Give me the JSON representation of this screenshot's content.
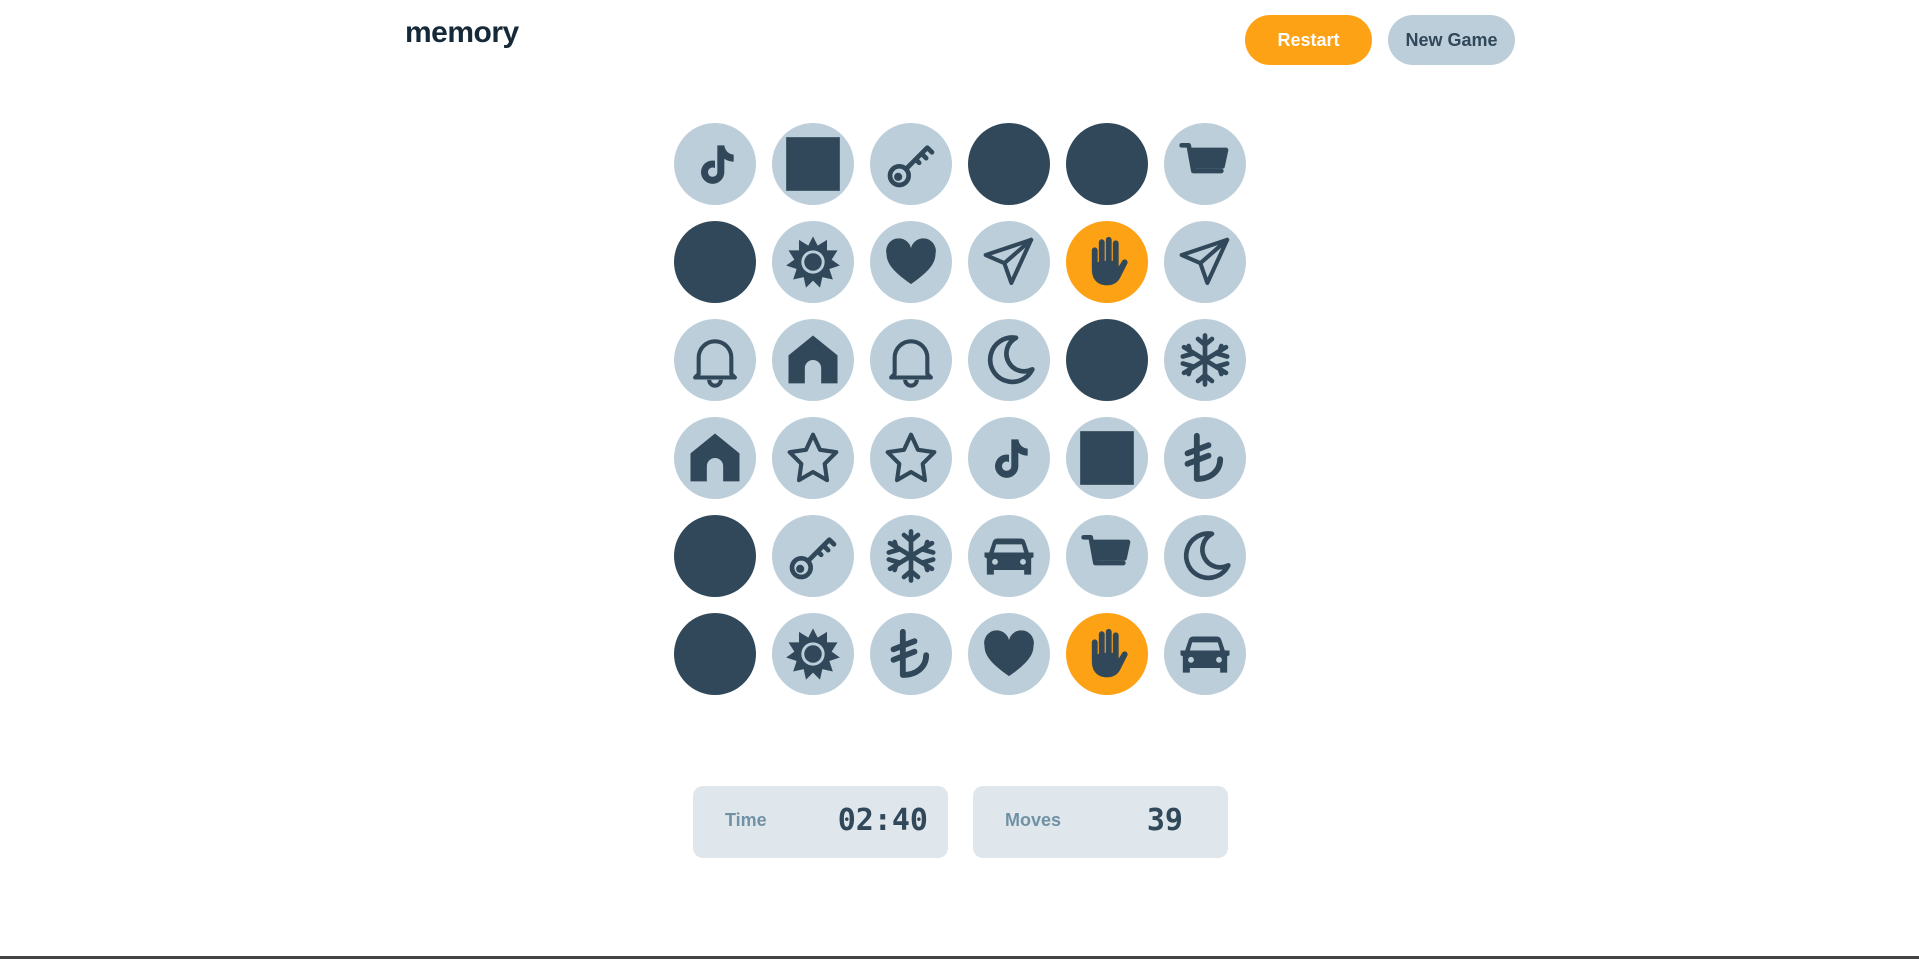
{
  "header": {
    "logo": "memory",
    "restart_label": "Restart",
    "new_game_label": "New Game"
  },
  "colors": {
    "hidden": "#304859",
    "matched": "#BCCED9",
    "active": "#FDA214",
    "icon": "#304859",
    "stat_bg": "#DFE7EC"
  },
  "board": {
    "columns": 6,
    "tiles": [
      {
        "state": "matched",
        "icon": "tiktok-icon"
      },
      {
        "state": "matched",
        "icon": "square-icon"
      },
      {
        "state": "matched",
        "icon": "key-icon"
      },
      {
        "state": "hidden",
        "icon": ""
      },
      {
        "state": "hidden",
        "icon": ""
      },
      {
        "state": "matched",
        "icon": "cart-icon"
      },
      {
        "state": "hidden",
        "icon": ""
      },
      {
        "state": "matched",
        "icon": "sun-icon"
      },
      {
        "state": "matched",
        "icon": "heart-icon"
      },
      {
        "state": "matched",
        "icon": "paper-plane-icon"
      },
      {
        "state": "active",
        "icon": "hand-icon"
      },
      {
        "state": "matched",
        "icon": "paper-plane-icon"
      },
      {
        "state": "matched",
        "icon": "bell-icon"
      },
      {
        "state": "matched",
        "icon": "house-icon"
      },
      {
        "state": "matched",
        "icon": "bell-icon"
      },
      {
        "state": "matched",
        "icon": "moon-icon"
      },
      {
        "state": "hidden",
        "icon": ""
      },
      {
        "state": "matched",
        "icon": "snowflake-icon"
      },
      {
        "state": "matched",
        "icon": "house-icon"
      },
      {
        "state": "matched",
        "icon": "star-icon"
      },
      {
        "state": "matched",
        "icon": "star-icon"
      },
      {
        "state": "matched",
        "icon": "tiktok-icon"
      },
      {
        "state": "matched",
        "icon": "square-icon"
      },
      {
        "state": "matched",
        "icon": "lira-icon"
      },
      {
        "state": "hidden",
        "icon": ""
      },
      {
        "state": "matched",
        "icon": "key-icon"
      },
      {
        "state": "matched",
        "icon": "snowflake-icon"
      },
      {
        "state": "matched",
        "icon": "car-icon"
      },
      {
        "state": "matched",
        "icon": "cart-icon"
      },
      {
        "state": "matched",
        "icon": "moon-icon"
      },
      {
        "state": "hidden",
        "icon": ""
      },
      {
        "state": "matched",
        "icon": "sun-icon"
      },
      {
        "state": "matched",
        "icon": "lira-icon"
      },
      {
        "state": "matched",
        "icon": "heart-icon"
      },
      {
        "state": "active",
        "icon": "hand-icon"
      },
      {
        "state": "matched",
        "icon": "car-icon"
      }
    ]
  },
  "stats": {
    "time_label": "Time",
    "time_value": "02:40",
    "moves_label": "Moves",
    "moves_value": "39"
  }
}
